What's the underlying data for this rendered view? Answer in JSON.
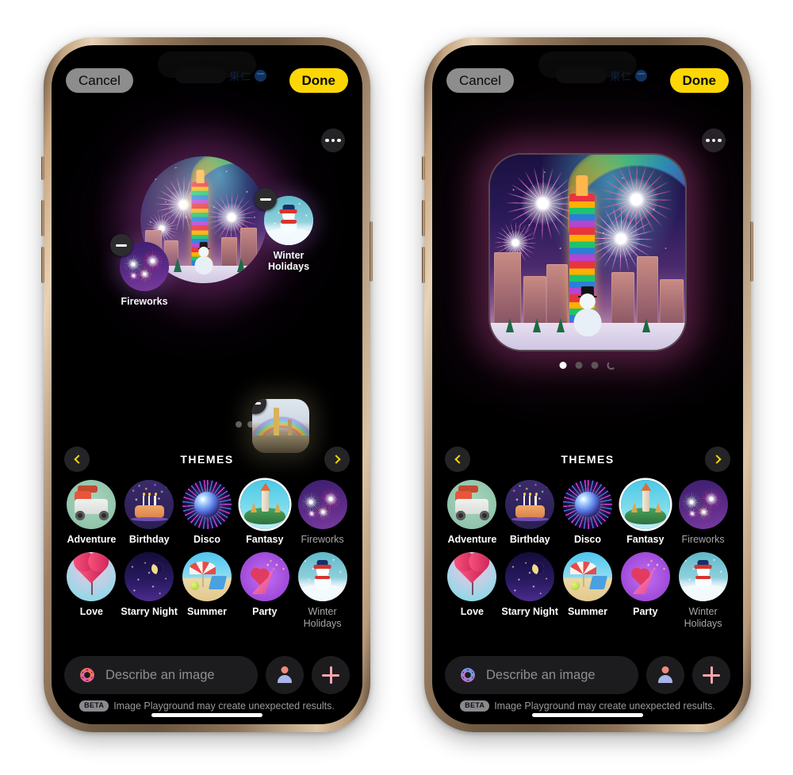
{
  "app": {
    "name": "Image Playground",
    "accent_yellow": "#FCD703",
    "bg": "#000000"
  },
  "navbar": {
    "cancel_label": "Cancel",
    "done_label": "Done",
    "status_text": "果仁"
  },
  "canvas": {
    "more_icon": "ellipsis-icon",
    "floating_concepts": [
      {
        "label": "Fireworks",
        "art": "fireworks"
      },
      {
        "label": "Winter\nHolidays",
        "art": "winter"
      }
    ],
    "fireworks_label": "Fireworks",
    "winter_label_line1": "Winter",
    "winter_label_line2": "Holidays",
    "photo_thumb_name": "source-photo-thumbnail"
  },
  "preview": {
    "page_count": 3,
    "active_page": 1,
    "loading": true
  },
  "themes": {
    "title": "THEMES",
    "prev_label": "chevron-left-icon",
    "next_label": "chevron-right-icon",
    "items": [
      {
        "label": "Adventure",
        "art": "adventure",
        "selected": false,
        "dim": false
      },
      {
        "label": "Birthday",
        "art": "birthday",
        "selected": false,
        "dim": false
      },
      {
        "label": "Disco",
        "art": "disco",
        "selected": false,
        "dim": false
      },
      {
        "label": "Fantasy",
        "art": "fantasy",
        "selected": true,
        "dim": false
      },
      {
        "label": "Fireworks",
        "art": "fireworks",
        "selected": false,
        "dim": true
      },
      {
        "label": "Love",
        "art": "love",
        "selected": false,
        "dim": false
      },
      {
        "label": "Starry Night",
        "art": "starry",
        "selected": false,
        "dim": false
      },
      {
        "label": "Summer",
        "art": "summer",
        "selected": false,
        "dim": false
      },
      {
        "label": "Party",
        "art": "party",
        "selected": false,
        "dim": false
      },
      {
        "label": "Winter Holidays",
        "art": "winter",
        "selected": false,
        "dim": true
      }
    ],
    "labels": {
      "adventure": "Adventure",
      "birthday": "Birthday",
      "disco": "Disco",
      "fantasy": "Fantasy",
      "fireworks": "Fireworks",
      "love": "Love",
      "starry": "Starry Night",
      "summer": "Summer",
      "party": "Party",
      "winter_line1": "Winter",
      "winter_line2": "Holidays"
    }
  },
  "composer": {
    "placeholder": "Describe an image",
    "value": "",
    "playground_icon": "image-playground-icon",
    "person_button": "person-icon",
    "add_button": "plus-icon"
  },
  "disclaimer": {
    "badge": "BETA",
    "text": "Image Playground may create unexpected results."
  }
}
